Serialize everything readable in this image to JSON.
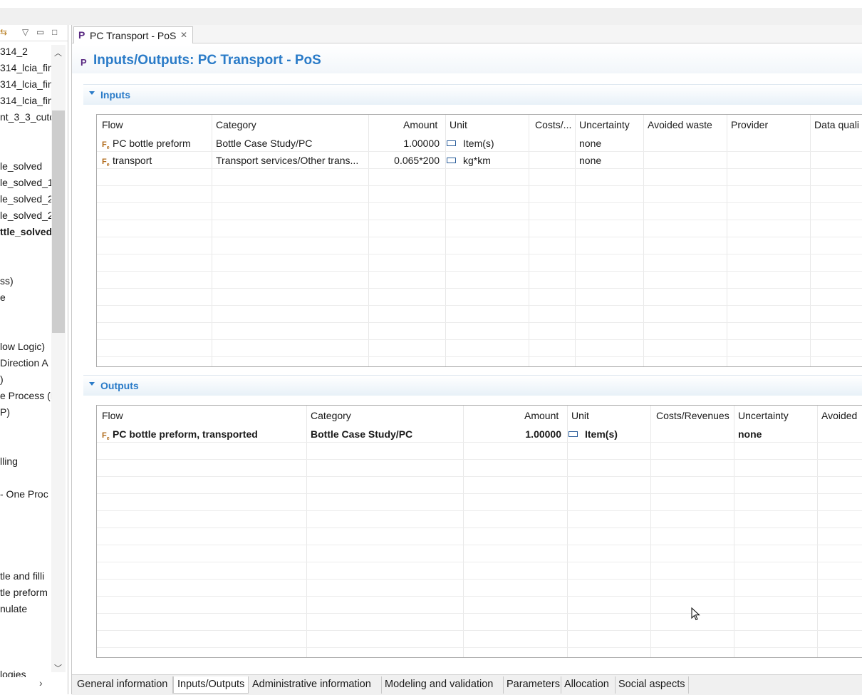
{
  "nav": {
    "toolbar_icons": [
      "link-editor-icon",
      "view-menu-icon",
      "minimize-icon",
      "maximize-icon"
    ],
    "items": [
      {
        "label": "314_2",
        "bold": false
      },
      {
        "label": "314_lcia_fin",
        "bold": false
      },
      {
        "label": "314_lcia_fin",
        "bold": false
      },
      {
        "label": "314_lcia_fin",
        "bold": false
      },
      {
        "label": "nt_3_3_cutc",
        "bold": false
      },
      {
        "label": "le_solved",
        "bold": false
      },
      {
        "label": "le_solved_1",
        "bold": false
      },
      {
        "label": "le_solved_2",
        "bold": false
      },
      {
        "label": "le_solved_2",
        "bold": false
      },
      {
        "label": "ttle_solved",
        "bold": true
      },
      {
        "label": "ss)",
        "bold": false
      },
      {
        "label": "e",
        "bold": false
      },
      {
        "label": "low Logic)",
        "bold": false
      },
      {
        "label": "Direction A",
        "bold": false
      },
      {
        "label": ")",
        "bold": false
      },
      {
        "label": "e Process (P",
        "bold": false
      },
      {
        "label": "P)",
        "bold": false
      },
      {
        "label": "lling",
        "bold": false
      },
      {
        "label": "- One Proc",
        "bold": false
      },
      {
        "label": "tle and filli",
        "bold": false
      },
      {
        "label": "tle preform",
        "bold": false
      },
      {
        "label": "nulate",
        "bold": false
      },
      {
        "label": "logies",
        "bold": false
      }
    ]
  },
  "editor": {
    "tab_icon": "P",
    "tab_title": "PC Transport - PoS",
    "header_icon": "P",
    "header_title": "Inputs/Outputs: PC Transport - PoS"
  },
  "inputs": {
    "title": "Inputs",
    "columns": [
      "Flow",
      "Category",
      "Amount",
      "Unit",
      "Costs/...",
      "Uncertainty",
      "Avoided waste",
      "Provider",
      "Data quali"
    ],
    "rows": [
      {
        "flow": "PC bottle preform",
        "category": "Bottle Case Study/PC",
        "amount": "1.00000",
        "unit": "Item(s)",
        "costs": "",
        "uncertainty": "none"
      },
      {
        "flow": "transport",
        "category": "Transport services/Other trans...",
        "amount": "0.065*200",
        "unit": "kg*km",
        "costs": "",
        "uncertainty": "none"
      }
    ]
  },
  "outputs": {
    "title": "Outputs",
    "columns": [
      "Flow",
      "Category",
      "Amount",
      "Unit",
      "Costs/Revenues",
      "Uncertainty",
      "Avoided"
    ],
    "rows": [
      {
        "flow": "PC bottle preform, transported",
        "category": "Bottle Case Study/PC",
        "amount": "1.00000",
        "unit": "Item(s)",
        "costs": "",
        "uncertainty": "none"
      }
    ]
  },
  "bottom_tabs": [
    {
      "label": "General information",
      "active": false
    },
    {
      "label": "Inputs/Outputs",
      "active": true
    },
    {
      "label": "Administrative information",
      "active": false
    },
    {
      "label": "Modeling and validation",
      "active": false
    },
    {
      "label": "Parameters",
      "active": false
    },
    {
      "label": "Allocation",
      "active": false
    },
    {
      "label": "Social aspects",
      "active": false
    }
  ],
  "colors": {
    "accent": "#2a7bc8",
    "process_icon": "#5a2a82",
    "flow_icon": "#b06a1a"
  }
}
